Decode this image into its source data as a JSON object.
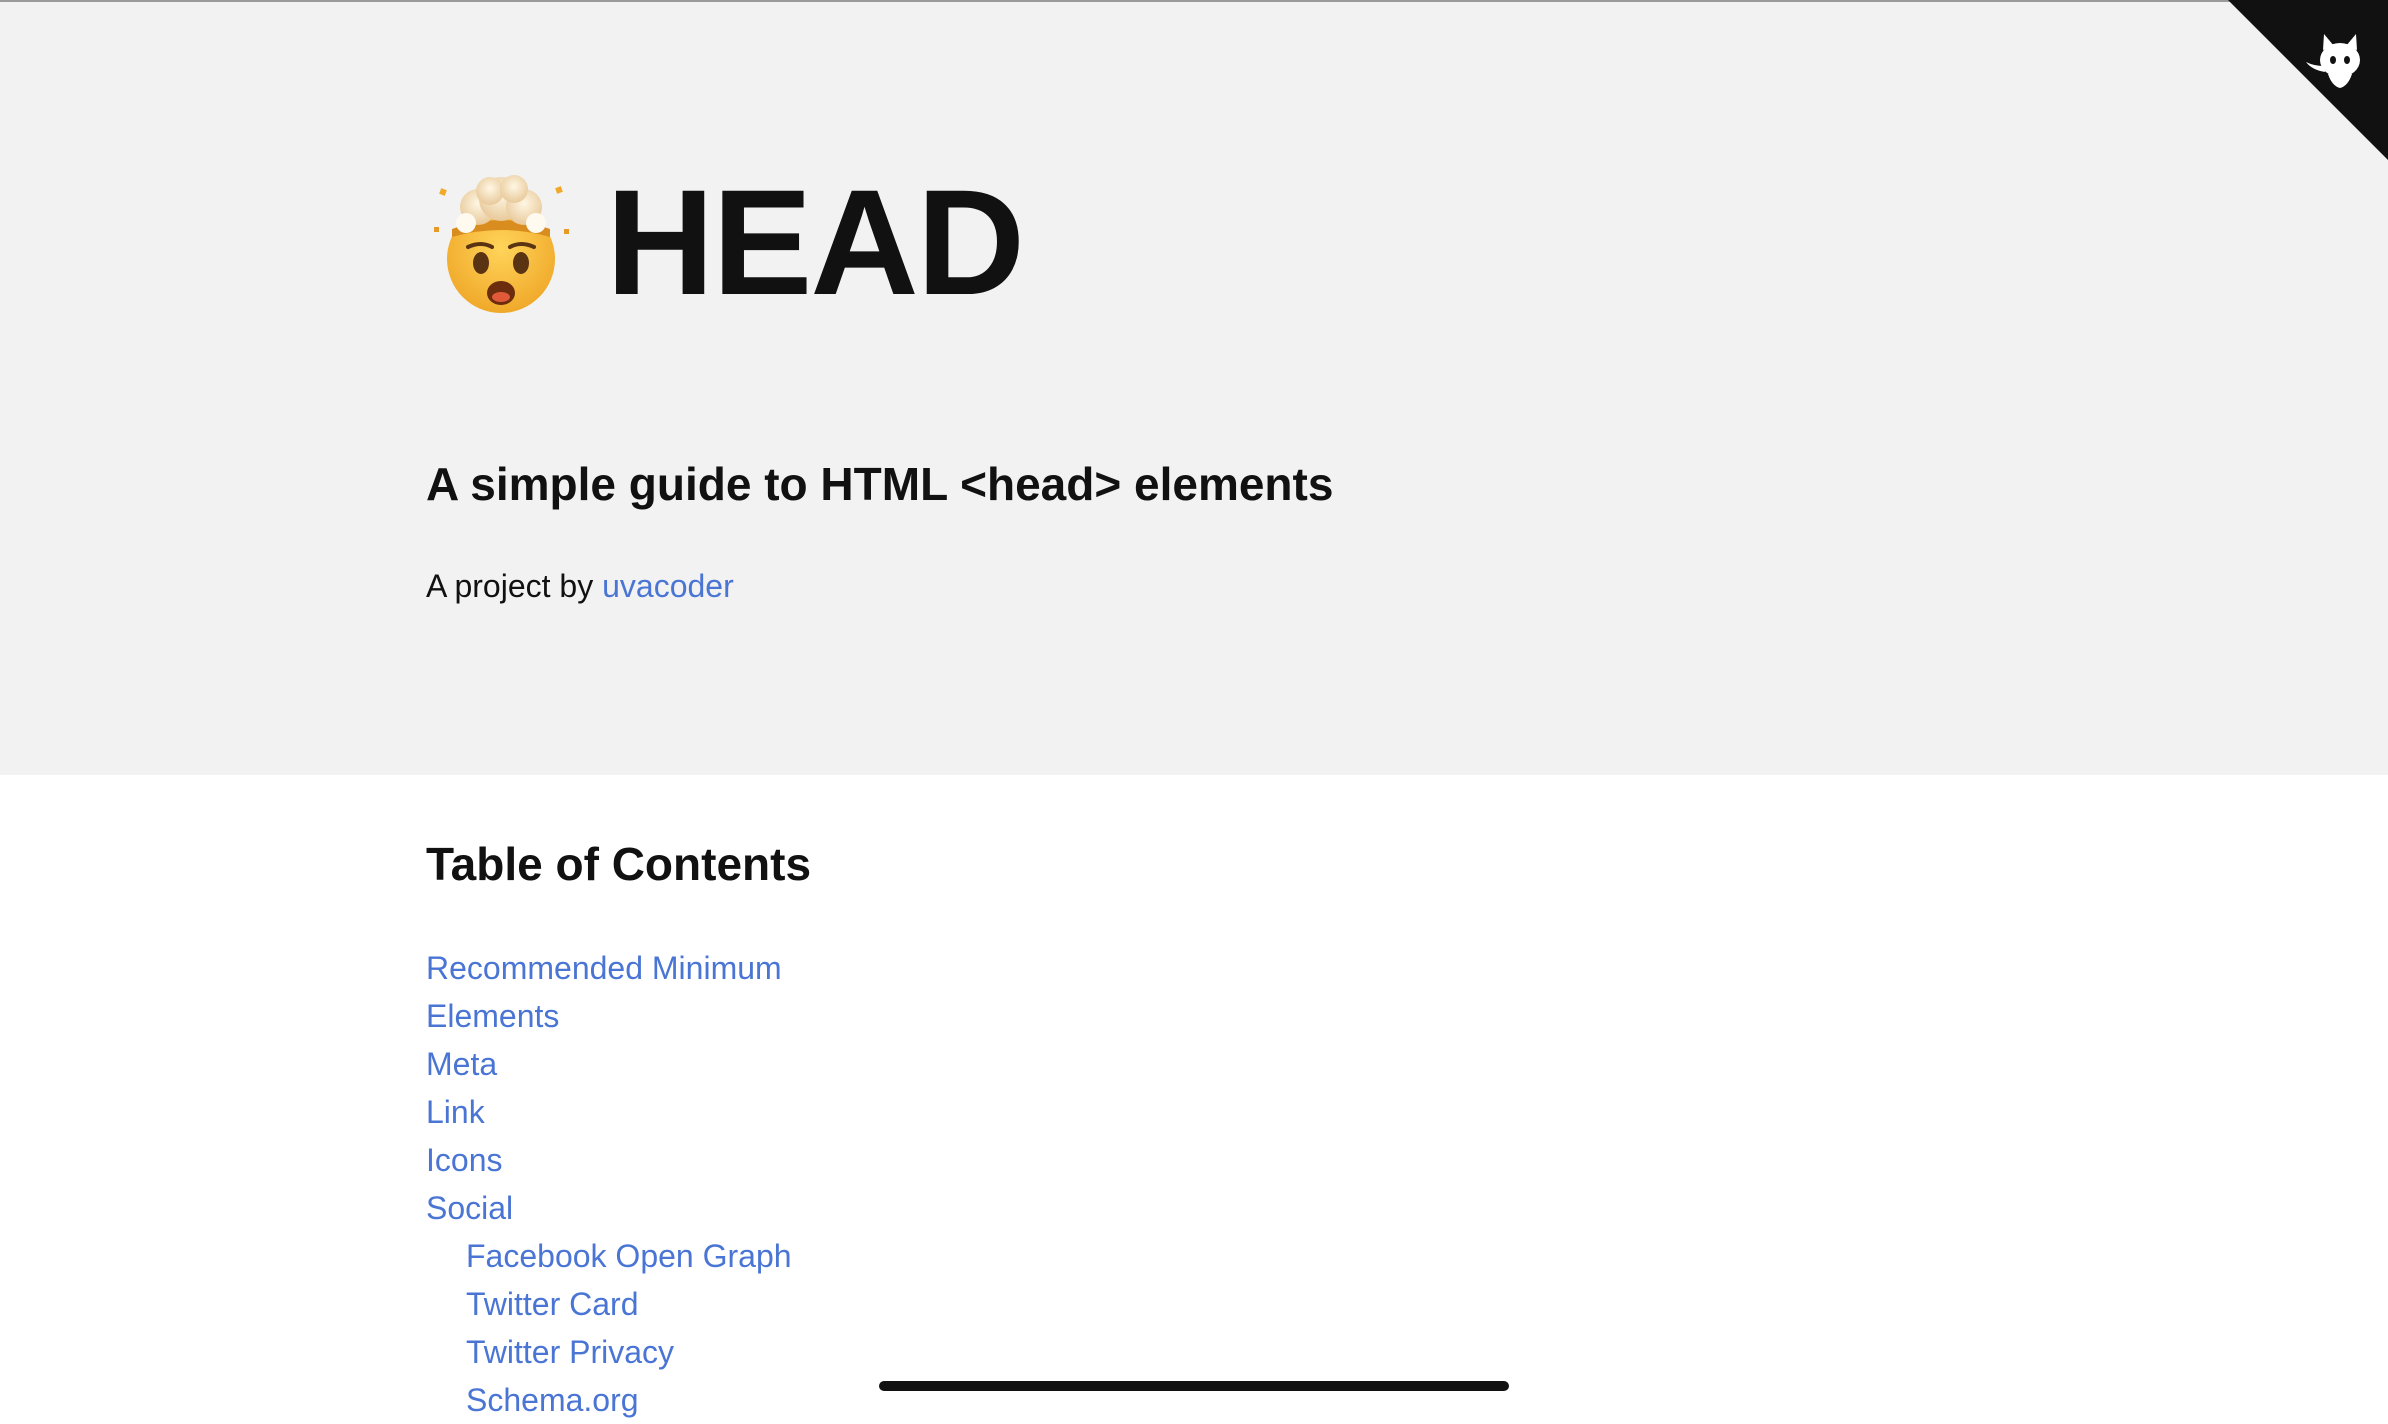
{
  "hero": {
    "title": "HEAD",
    "subtitle": "A simple guide to HTML <head> elements",
    "byline_prefix": "A project by ",
    "author_link": "uvacoder"
  },
  "github_corner": {
    "icon": "github-octocat-icon"
  },
  "toc": {
    "title": "Table of Contents",
    "items": [
      {
        "label": "Recommended Minimum",
        "level": 1
      },
      {
        "label": "Elements",
        "level": 1
      },
      {
        "label": "Meta",
        "level": 1
      },
      {
        "label": "Link",
        "level": 1
      },
      {
        "label": "Icons",
        "level": 1
      },
      {
        "label": "Social",
        "level": 1
      },
      {
        "label": "Facebook Open Graph",
        "level": 2
      },
      {
        "label": "Twitter Card",
        "level": 2
      },
      {
        "label": "Twitter Privacy",
        "level": 2
      },
      {
        "label": "Schema.org",
        "level": 2
      }
    ]
  },
  "colors": {
    "hero_background": "#f2f2f2",
    "link": "#4a75d4",
    "text": "#111111"
  }
}
